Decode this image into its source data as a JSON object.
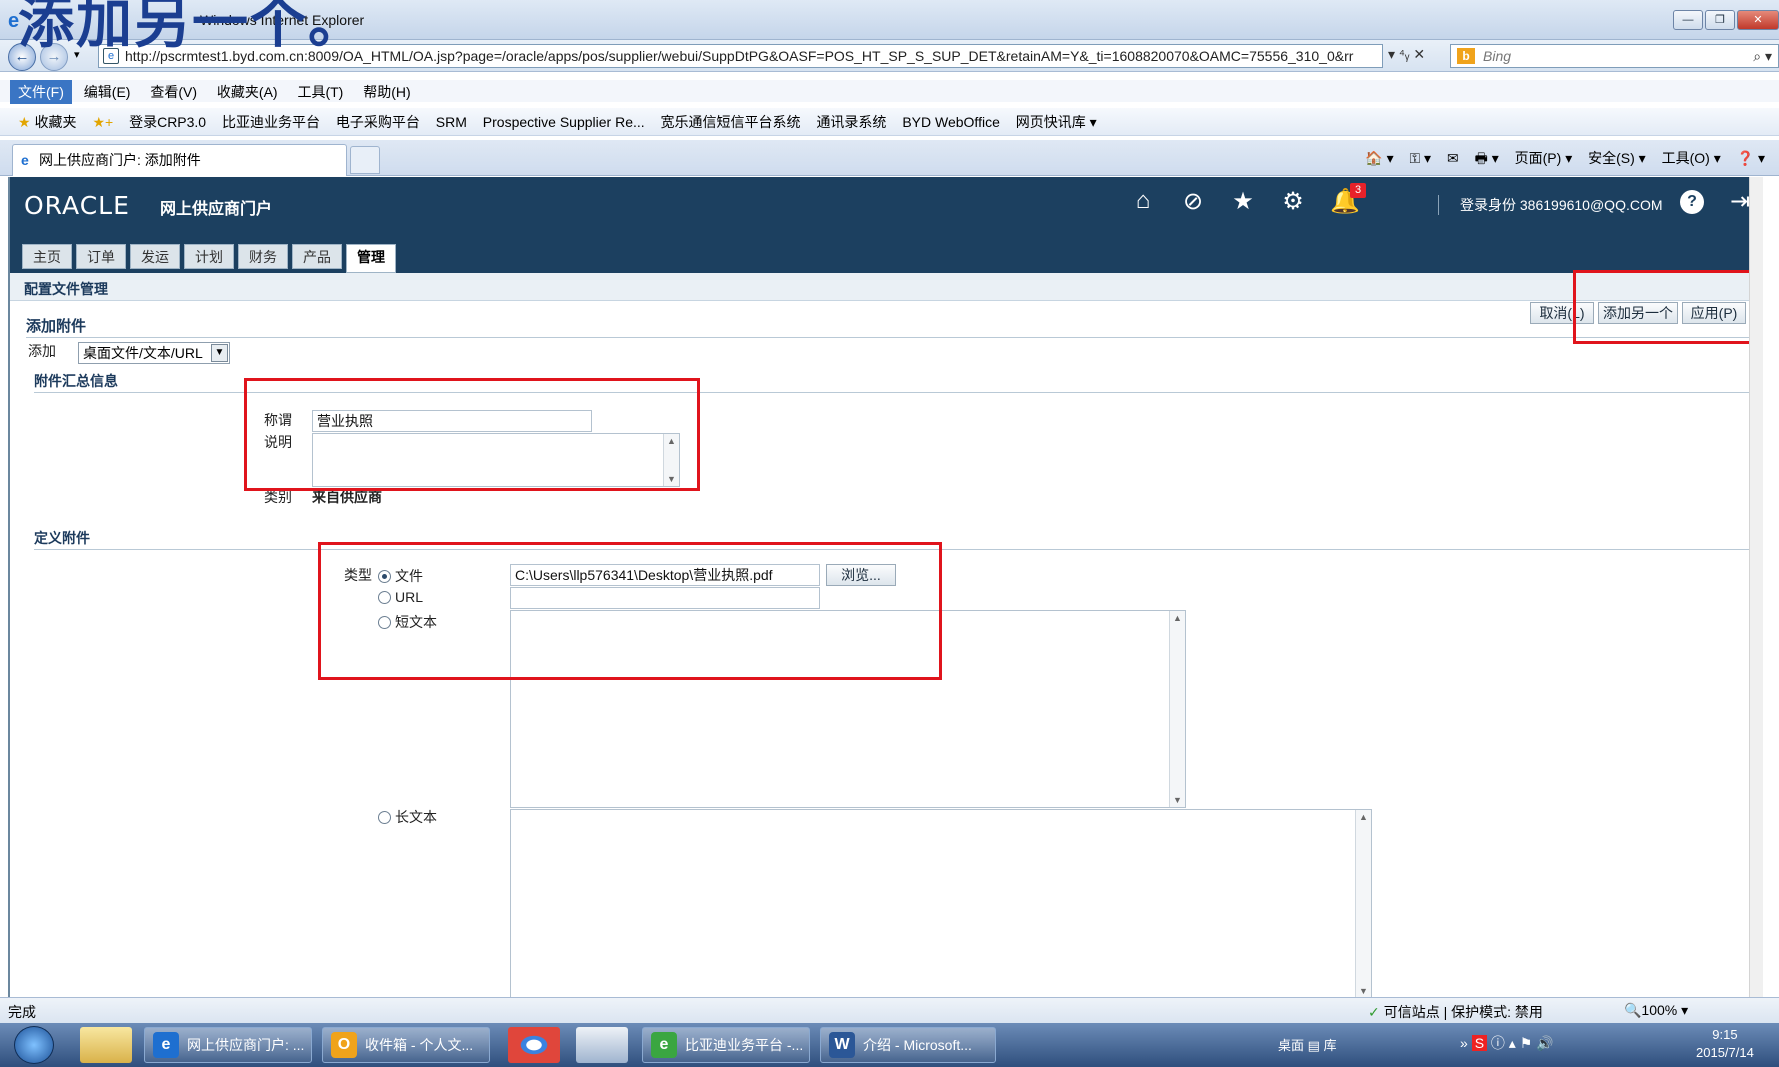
{
  "window": {
    "overlay_text": "添加另一个。",
    "title": "Windows Internet Explorer",
    "btn_min": "—",
    "btn_max": "❐",
    "btn_close": "✕"
  },
  "addressbar": {
    "url": "http://pscrmtest1.byd.com.cn:8009/OA_HTML/OA.jsp?page=/oracle/apps/pos/supplier/webui/SuppDtPG&OASF=POS_HT_SP_S_SUP_DET&retainAM=Y&_ti=1608820070&OAMC=75556_310_0&rr",
    "tools": "▾  ⁴ᵧ  ✕",
    "search_placeholder": "Bing"
  },
  "menubar": [
    "文件(F)",
    "编辑(E)",
    "查看(V)",
    "收藏夹(A)",
    "工具(T)",
    "帮助(H)"
  ],
  "favorites": {
    "label": "收藏夹",
    "items": [
      "登录CRP3.0",
      "比亚迪业务平台",
      "电子采购平台",
      "SRM",
      "Prospective Supplier Re...",
      "宽乐通信短信平台系统",
      "通讯录系统",
      "BYD WebOffice",
      "网页快讯库 ▾"
    ]
  },
  "browser_tab": {
    "title": "网上供应商门户: 添加附件"
  },
  "command_bar": [
    "🏠 ▾",
    "⚿ ▾",
    "✉",
    "🖶 ▾",
    "页面(P) ▾",
    "安全(S) ▾",
    "工具(O) ▾",
    "❓ ▾"
  ],
  "oracle": {
    "logo": "ORACLE",
    "app_name": "网上供应商门户",
    "notification_count": "3",
    "login_label": "登录身份 386199610@QQ.COM",
    "help": "?",
    "tabs": [
      "主页",
      "订单",
      "发运",
      "计划",
      "财务",
      "产品",
      "管理"
    ],
    "active_tab": "管理",
    "subnav": "配置文件管理"
  },
  "form": {
    "title": "添加附件",
    "buttons": {
      "cancel": "取消(L)",
      "add_another": "添加另一个",
      "apply": "应用(P)"
    },
    "add_label": "添加",
    "add_select": "桌面文件/文本/URL",
    "summary_section": "附件汇总信息",
    "title_label": "称谓",
    "title_value": "营业执照",
    "desc_label": "说明",
    "category_label": "类别",
    "category_value": "来自供应商",
    "define_section": "定义附件",
    "type_label": "类型",
    "types": {
      "file": "文件",
      "url": "URL",
      "short_text": "短文本",
      "long_text": "长文本"
    },
    "file_path": "C:\\Users\\llp576341\\Desktop\\营业执照.pdf",
    "browse": "浏览..."
  },
  "statusbar": {
    "left": "完成",
    "zone": "可信站点 | 保护模式: 禁用",
    "zoom": "🔍100%  ▾"
  },
  "taskbar": {
    "tasks": [
      "网上供应商门户: ...",
      "收件箱 - 个人文...",
      "比亚迪业务平台 -...",
      "介绍 - Microsoft..."
    ],
    "desktop": "桌面",
    "library": "库",
    "time": "9:15",
    "date": "2015/7/14"
  }
}
